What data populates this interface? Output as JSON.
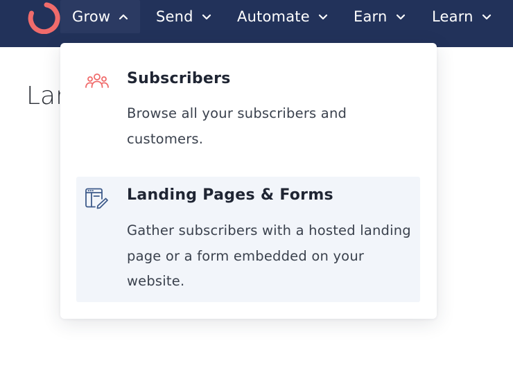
{
  "nav": {
    "logo_name": "convertkit-logo",
    "items": [
      {
        "label": "Grow",
        "chevron": "chevron-up-icon",
        "active": true
      },
      {
        "label": "Send",
        "chevron": "chevron-down-icon",
        "active": false
      },
      {
        "label": "Automate",
        "chevron": "chevron-down-icon",
        "active": false
      },
      {
        "label": "Earn",
        "chevron": "chevron-down-icon",
        "active": false
      },
      {
        "label": "Learn",
        "chevron": "chevron-down-icon",
        "active": false
      }
    ]
  },
  "page": {
    "title": "Lar"
  },
  "dropdown": {
    "entries": [
      {
        "icon": "people-group-icon",
        "title": "Subscribers",
        "description": "Browse all your subscribers and customers."
      },
      {
        "icon": "landing-page-form-icon",
        "title": "Landing Pages & Forms",
        "description": "Gather subscribers with a hosted landing page or a form embedded on your website."
      }
    ]
  },
  "colors": {
    "navbar_bg": "#22325a",
    "logo_accent": "#f06b6b",
    "icon_blue": "#3d5a8a",
    "hover_bg": "#f2f5fa"
  }
}
